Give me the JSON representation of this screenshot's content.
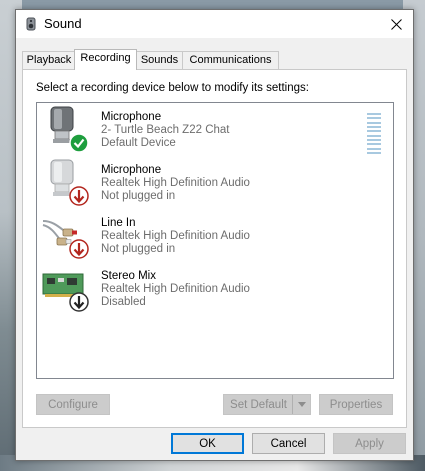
{
  "window": {
    "title": "Sound",
    "icon": "speaker-icon",
    "close_icon": "close-icon"
  },
  "tabs": [
    {
      "label": "Playback",
      "active": false
    },
    {
      "label": "Recording",
      "active": true
    },
    {
      "label": "Sounds",
      "active": false
    },
    {
      "label": "Communications",
      "active": false
    }
  ],
  "instruction": "Select a recording device below to modify its settings:",
  "devices": [
    {
      "name": "Microphone",
      "description": "2- Turtle Beach Z22 Chat",
      "status": "Default Device",
      "icon": "microphone-icon",
      "badge": "green-checkmark-icon"
    },
    {
      "name": "Microphone",
      "description": "Realtek High Definition Audio",
      "status": "Not plugged in",
      "icon": "microphone-icon",
      "badge": "red-down-arrow-icon"
    },
    {
      "name": "Line In",
      "description": "Realtek High Definition Audio",
      "status": "Not plugged in",
      "icon": "rca-cable-icon",
      "badge": "red-down-arrow-icon"
    },
    {
      "name": "Stereo Mix",
      "description": "Realtek High Definition Audio",
      "status": "Disabled",
      "icon": "sound-card-icon",
      "badge": "black-down-arrow-icon"
    }
  ],
  "buttons": {
    "configure": "Configure",
    "set_default": "Set Default",
    "properties": "Properties",
    "ok": "OK",
    "cancel": "Cancel",
    "apply": "Apply"
  },
  "colors": {
    "accent": "#0078d7",
    "default_badge": "#1e9e3e",
    "unplugged_badge": "#b3261e"
  }
}
